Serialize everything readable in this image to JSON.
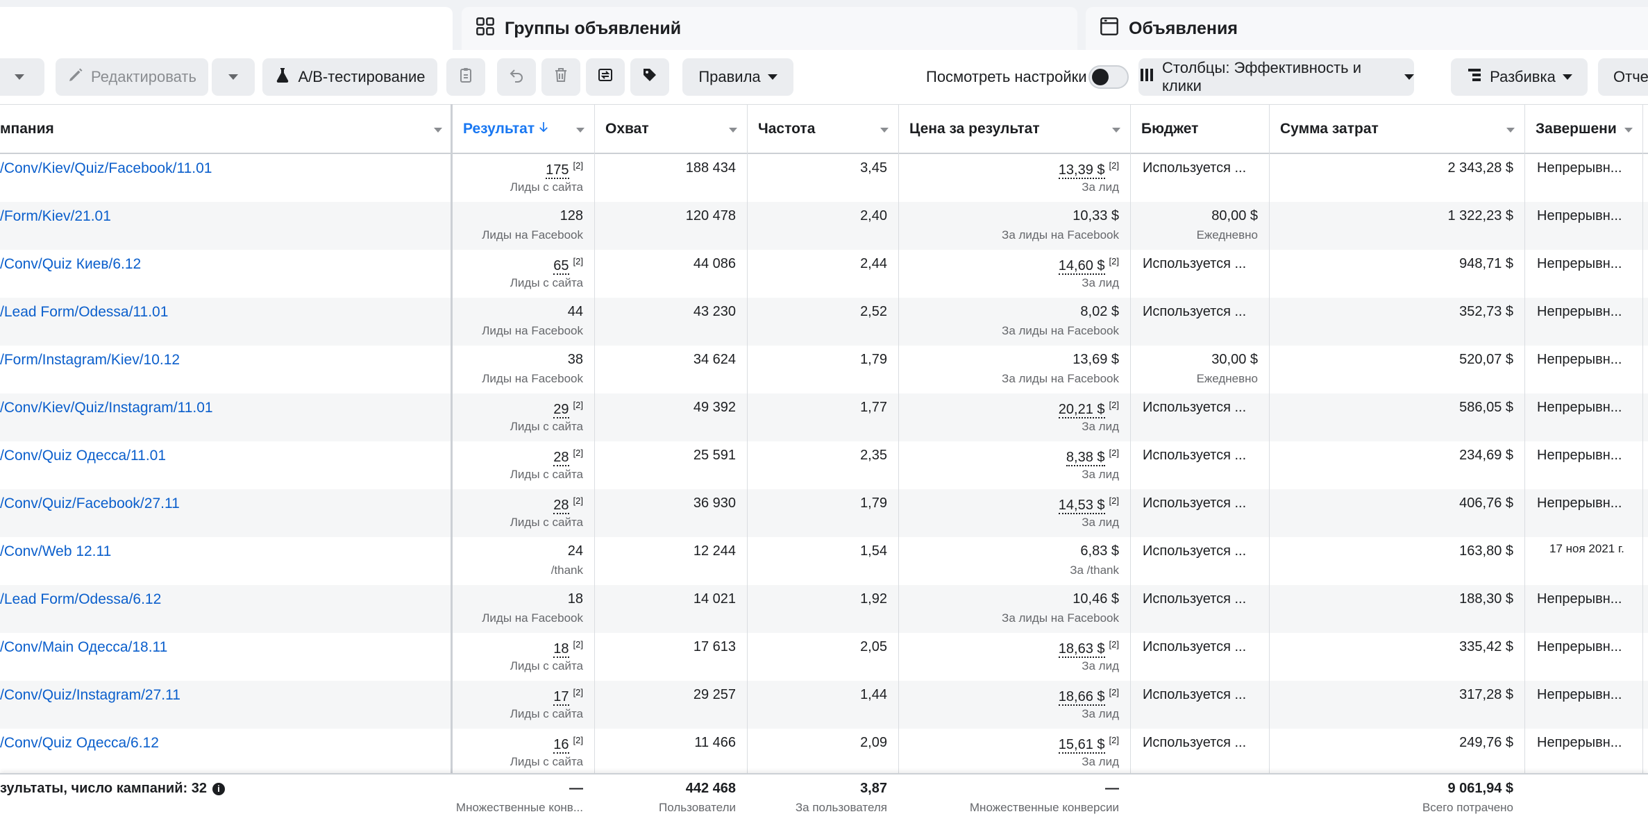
{
  "tabs": {
    "adsets": "Группы объявлений",
    "ads": "Объявления"
  },
  "toolbar": {
    "edit": "Редактировать",
    "ab_test": "A/B-тестирование",
    "rules": "Правила",
    "view_settings": "Посмотреть настройки",
    "columns": "Столбцы: Эффективность и клики",
    "breakdown": "Разбивка",
    "reports": "Отчет"
  },
  "headers": {
    "name": "мпания",
    "result": "Результат",
    "reach": "Охват",
    "frequency": "Частота",
    "cpr": "Цена за результат",
    "budget": "Бюджет",
    "spend": "Сумма затрат",
    "end": "Завершени"
  },
  "rows": [
    {
      "name": "/Conv/Kiev/Quiz/Facebook/11.01",
      "result": "175",
      "result_fn": "[2]",
      "result_sub": "Лиды с сайта",
      "reach": "188 434",
      "freq": "3,45",
      "cpr": "13,39 $",
      "cpr_fn": "[2]",
      "cpr_sub": "За лид",
      "budget": "Используется ...",
      "budget_sub": "",
      "spend": "2 343,28 $",
      "end": "Непрерывн..."
    },
    {
      "name": "/Form/Kiev/21.01",
      "result": "128",
      "result_fn": "",
      "result_sub": "Лиды на Facebook",
      "reach": "120 478",
      "freq": "2,40",
      "cpr": "10,33 $",
      "cpr_fn": "",
      "cpr_sub": "За лиды на Facebook",
      "budget": "80,00 $",
      "budget_sub": "Ежедневно",
      "spend": "1 322,23 $",
      "end": "Непрерывн..."
    },
    {
      "name": "/Conv/Quiz Киев/6.12",
      "result": "65",
      "result_fn": "[2]",
      "result_sub": "Лиды с сайта",
      "reach": "44 086",
      "freq": "2,44",
      "cpr": "14,60 $",
      "cpr_fn": "[2]",
      "cpr_sub": "За лид",
      "budget": "Используется ...",
      "budget_sub": "",
      "spend": "948,71 $",
      "end": "Непрерывн..."
    },
    {
      "name": "/Lead Form/Odessa/11.01",
      "result": "44",
      "result_fn": "",
      "result_sub": "Лиды на Facebook",
      "reach": "43 230",
      "freq": "2,52",
      "cpr": "8,02 $",
      "cpr_fn": "",
      "cpr_sub": "За лиды на Facebook",
      "budget": "Используется ...",
      "budget_sub": "",
      "spend": "352,73 $",
      "end": "Непрерывн..."
    },
    {
      "name": "/Form/Instagram/Kiev/10.12",
      "result": "38",
      "result_fn": "",
      "result_sub": "Лиды на Facebook",
      "reach": "34 624",
      "freq": "1,79",
      "cpr": "13,69 $",
      "cpr_fn": "",
      "cpr_sub": "За лиды на Facebook",
      "budget": "30,00 $",
      "budget_sub": "Ежедневно",
      "spend": "520,07 $",
      "end": "Непрерывн..."
    },
    {
      "name": "/Conv/Kiev/Quiz/Instagram/11.01",
      "result": "29",
      "result_fn": "[2]",
      "result_sub": "Лиды с сайта",
      "reach": "49 392",
      "freq": "1,77",
      "cpr": "20,21 $",
      "cpr_fn": "[2]",
      "cpr_sub": "За лид",
      "budget": "Используется ...",
      "budget_sub": "",
      "spend": "586,05 $",
      "end": "Непрерывн..."
    },
    {
      "name": "/Conv/Quiz Одесса/11.01",
      "result": "28",
      "result_fn": "[2]",
      "result_sub": "Лиды с сайта",
      "reach": "25 591",
      "freq": "2,35",
      "cpr": "8,38 $",
      "cpr_fn": "[2]",
      "cpr_sub": "За лид",
      "budget": "Используется ...",
      "budget_sub": "",
      "spend": "234,69 $",
      "end": "Непрерывн..."
    },
    {
      "name": "/Conv/Quiz/Facebook/27.11",
      "result": "28",
      "result_fn": "[2]",
      "result_sub": "Лиды с сайта",
      "reach": "36 930",
      "freq": "1,79",
      "cpr": "14,53 $",
      "cpr_fn": "[2]",
      "cpr_sub": "За лид",
      "budget": "Используется ...",
      "budget_sub": "",
      "spend": "406,76 $",
      "end": "Непрерывн..."
    },
    {
      "name": "/Conv/Web 12.11",
      "result": "24",
      "result_fn": "",
      "result_sub": "/thank",
      "reach": "12 244",
      "freq": "1,54",
      "cpr": "6,83 $",
      "cpr_fn": "",
      "cpr_sub": "За /thank",
      "budget": "Используется ...",
      "budget_sub": "",
      "spend": "163,80 $",
      "end": "17 ноя 2021 г."
    },
    {
      "name": "/Lead Form/Odessa/6.12",
      "result": "18",
      "result_fn": "",
      "result_sub": "Лиды на Facebook",
      "reach": "14 021",
      "freq": "1,92",
      "cpr": "10,46 $",
      "cpr_fn": "",
      "cpr_sub": "За лиды на Facebook",
      "budget": "Используется ...",
      "budget_sub": "",
      "spend": "188,30 $",
      "end": "Непрерывн..."
    },
    {
      "name": "/Conv/Main Одесса/18.11",
      "result": "18",
      "result_fn": "[2]",
      "result_sub": "Лиды с сайта",
      "reach": "17 613",
      "freq": "2,05",
      "cpr": "18,63 $",
      "cpr_fn": "[2]",
      "cpr_sub": "За лид",
      "budget": "Используется ...",
      "budget_sub": "",
      "spend": "335,42 $",
      "end": "Непрерывн..."
    },
    {
      "name": "/Conv/Quiz/Instagram/27.11",
      "result": "17",
      "result_fn": "[2]",
      "result_sub": "Лиды с сайта",
      "reach": "29 257",
      "freq": "1,44",
      "cpr": "18,66 $",
      "cpr_fn": "[2]",
      "cpr_sub": "За лид",
      "budget": "Используется ...",
      "budget_sub": "",
      "spend": "317,28 $",
      "end": "Непрерывн..."
    },
    {
      "name": "/Conv/Quiz Одесса/6.12",
      "result": "16",
      "result_fn": "[2]",
      "result_sub": "Лиды с сайта",
      "reach": "11 466",
      "freq": "2,09",
      "cpr": "15,61 $",
      "cpr_fn": "[2]",
      "cpr_sub": "За лид",
      "budget": "Используется ...",
      "budget_sub": "",
      "spend": "249,76 $",
      "end": "Непрерывн..."
    }
  ],
  "totals": {
    "label": "зультаты, число кампаний: 32",
    "info": "i",
    "result": "—",
    "result_sub": "Множественные конв...",
    "reach": "442 468",
    "reach_sub": "Пользователи",
    "freq": "3,87",
    "freq_sub": "За пользователя",
    "cpr": "—",
    "cpr_sub": "Множественные конверсии",
    "spend": "9 061,94 $",
    "spend_sub": "Всего потрачено"
  }
}
